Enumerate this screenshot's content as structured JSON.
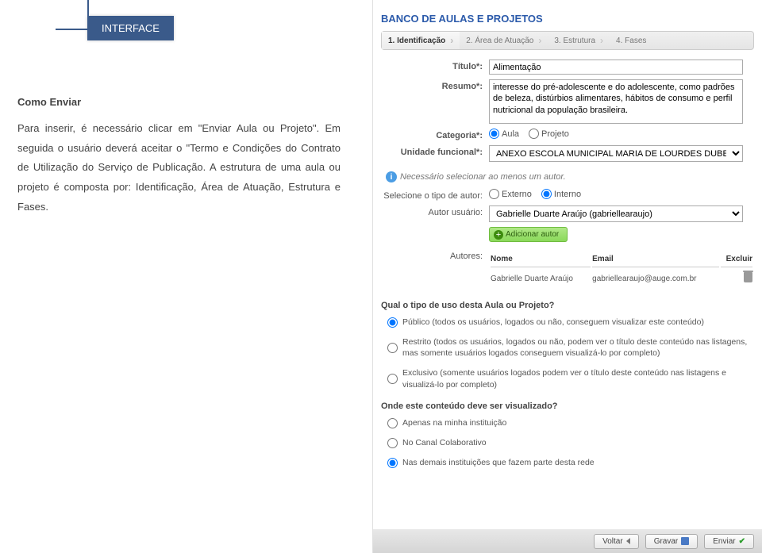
{
  "left": {
    "tab": "INTERFACE",
    "heading": "Como Enviar",
    "paragraph": "Para inserir, é necessário clicar em \"Enviar Aula ou Projeto\". Em seguida o usuário deverá aceitar o \"Termo e Condições do Contrato de Utilização do Serviço de Publicação. A estrutura de uma aula ou projeto é composta por: Identificação, Área de Atuação, Estrutura e Fases."
  },
  "app": {
    "title": "BANCO DE AULAS E PROJETOS",
    "tabs": [
      "1. Identificação",
      "2. Área de Atuação",
      "3. Estrutura",
      "4. Fases"
    ]
  },
  "form": {
    "titulo_label": "Título*:",
    "titulo_value": "Alimentação",
    "resumo_label": "Resumo*:",
    "resumo_value": "interesse do pré-adolescente e do adolescente, como padrões de beleza, distúrbios alimentares, hábitos de consumo e perfil nutricional da população brasileira.",
    "categoria_label": "Categoria*:",
    "categoria_options": [
      "Aula",
      "Projeto"
    ],
    "unidade_label": "Unidade funcional*:",
    "unidade_value": "ANEXO ESCOLA MUNICIPAL MARIA DE LOURDES DUBEUX I",
    "info_text": "Necessário selecionar ao menos um autor.",
    "tipo_autor_label": "Selecione o tipo de autor:",
    "tipo_autor_options": [
      "Externo",
      "Interno"
    ],
    "autor_usuario_label": "Autor usuário:",
    "autor_usuario_value": "Gabrielle Duarte Araújo (gabriellearaujo)",
    "add_author_btn": "Adicionar autor",
    "autores_label": "Autores:",
    "table_headers": [
      "Nome",
      "Email",
      "Excluir"
    ],
    "author_row": {
      "name": "Gabrielle Duarte Araújo",
      "email": "gabriellearaujo@auge.com.br"
    },
    "uso_title": "Qual o tipo de uso desta Aula ou Projeto?",
    "uso_options": [
      "Público (todos os usuários, logados ou não, conseguem visualizar este conteúdo)",
      "Restrito (todos os usuários, logados ou não, podem ver o título deste conteúdo nas listagens, mas somente usuários logados conseguem visualizá-lo por completo)",
      "Exclusivo (somente usuários logados podem ver o título deste conteúdo nas listagens e visualizá-lo por completo)"
    ],
    "vis_title": "Onde este conteúdo deve ser visualizado?",
    "vis_options": [
      "Apenas na minha instituição",
      "No Canal Colaborativo",
      "Nas demais instituições que fazem parte desta rede"
    ]
  },
  "buttons": {
    "voltar": "Voltar",
    "gravar": "Gravar",
    "enviar": "Enviar"
  }
}
